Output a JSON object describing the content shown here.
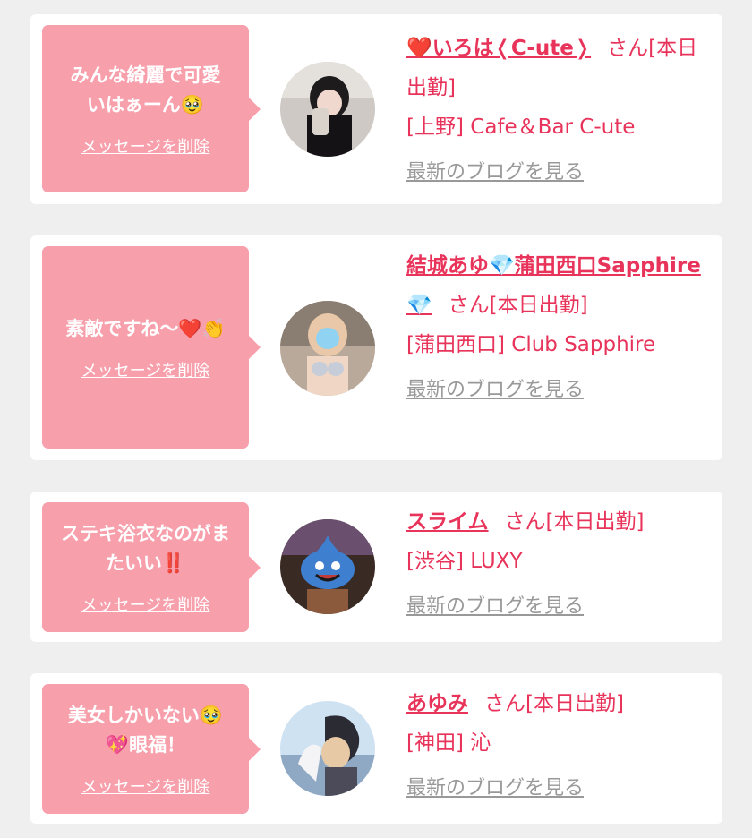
{
  "colors": {
    "page_bg": "#efefef",
    "card_bg": "#ffffff",
    "bubble_bg": "#f7a0ac",
    "accent": "#e8345a",
    "link_gray": "#999999"
  },
  "items": [
    {
      "message": "みんな綺麗で可愛いはぁーん🥹",
      "delete_label": "メッセージを削除",
      "name_prefix_icon": "heart-icon",
      "name": "❤️いろは❬C-ute❭",
      "honorific": "さん",
      "status": "[本日出勤]",
      "shop": "[上野] Cafe＆Bar C-ute",
      "blog_label": "最新のブログを見る",
      "avatar_icon": "girl-selfie-photo"
    },
    {
      "message": "素敵ですね〜❤️👏",
      "delete_label": "メッセージを削除",
      "name": "結城あゆ💎蒲田西口Sapphire💎",
      "honorific": "さん",
      "status": "[本日出勤]",
      "shop": "[蒲田西口] Club Sapphire",
      "blog_label": "最新のブログを見る",
      "avatar_icon": "girl-costume-photo"
    },
    {
      "message": "ステキ浴衣なのがまたいい‼️",
      "delete_label": "メッセージを削除",
      "name": "スライム",
      "honorific": "さん",
      "status": "[本日出勤]",
      "shop": "[渋谷] LUXY",
      "blog_label": "最新のブログを見る",
      "avatar_icon": "slime-mask-photo"
    },
    {
      "message": "美女しかいない🥹💖眼福！",
      "delete_label": "メッセージを削除",
      "name": "あゆみ",
      "honorific": "さん",
      "status": "[本日出勤]",
      "shop": "[神田] 沁",
      "blog_label": "最新のブログを見る",
      "avatar_icon": "anime-character-photo"
    }
  ]
}
